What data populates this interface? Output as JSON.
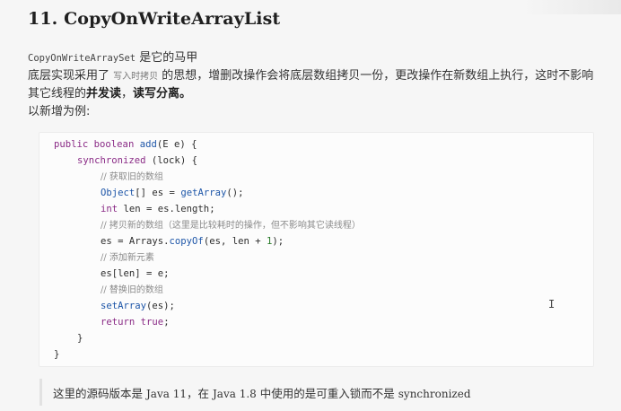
{
  "title": "11. CopyOnWriteArrayList",
  "intro": {
    "code_inline": "CopyOnWriteArraySet",
    "text_after": "是它的马甲"
  },
  "para2": {
    "part1": "底层实现采用了",
    "mark": "写入时拷贝",
    "part2": "的思想，增删改操作会将底层数组拷贝一份，更改操作在新数组上执行，这时不影响其它线程的",
    "bold1": "并发读",
    "sep": "，",
    "bold2": "读写分离。"
  },
  "para3": "以新增为例:",
  "code": {
    "l1_a": "public",
    "l1_b": "boolean",
    "l1_c": "add",
    "l1_d": "(E e) {",
    "l2_a": "synchronized",
    "l2_b": " (lock) {",
    "l3": "// 获取旧的数组",
    "l4_a": "Object",
    "l4_b": "[] es = ",
    "l4_c": "getArray",
    "l4_d": "();",
    "l5_a": "int",
    "l5_b": " len = es.length;",
    "l6": "// 拷贝新的数组（这里是比较耗时的操作，但不影响其它读线程）",
    "l7_a": "es = Arrays.",
    "l7_b": "copyOf",
    "l7_c": "(es, len + ",
    "l7_d": "1",
    "l7_e": ");",
    "l8": "// 添加新元素",
    "l9": "es[len] = e;",
    "l10": "// 替换旧的数组",
    "l11_a": "setArray",
    "l11_b": "(es);",
    "l12_a": "return",
    "l12_b": "true",
    "l12_c": ";",
    "l13": "}",
    "l14": "}"
  },
  "note": {
    "part1": "这里的源码版本是",
    "java11": "Java 11",
    "part2": "，在",
    "java18": "Java 1.8",
    "part3": "中使用的是可重入锁而不是",
    "sync": "synchronized"
  },
  "cursor_glyph": "I"
}
